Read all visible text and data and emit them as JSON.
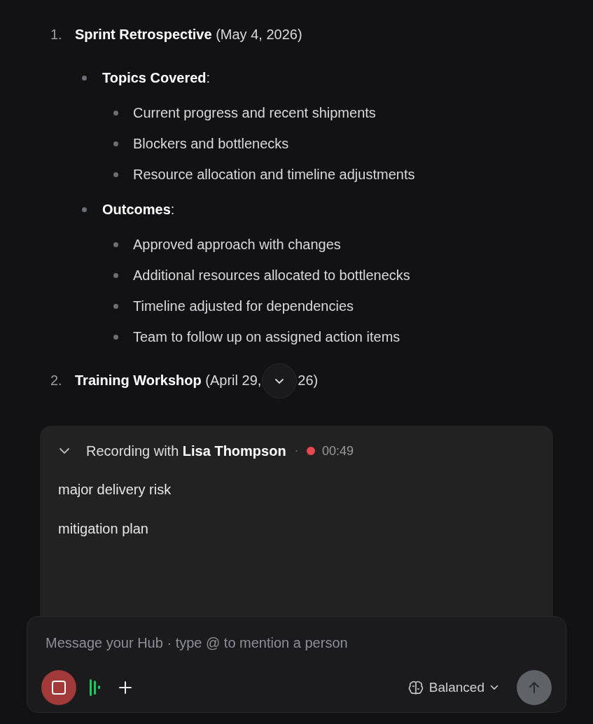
{
  "outline": [
    {
      "number": "1.",
      "text": "**Sprint Retrospective** (May 4, 2026)",
      "sections": [
        {
          "label": "**Topics Covered**:",
          "items": [
            "Current progress and recent shipments",
            "Blockers and bottlenecks",
            "Resource allocation and timeline adjustments"
          ]
        },
        {
          "label": "**Outcomes**:",
          "items": [
            "Approved approach with changes",
            "Additional resources allocated to bottlenecks",
            "Timeline adjusted for dependencies",
            "Team to follow up on assigned action items"
          ]
        }
      ]
    },
    {
      "number": "2.",
      "text": "**Training Workshop** (April 29,",
      "text_after": "26)"
    }
  ],
  "recording": {
    "expanded": true,
    "title": "Recording with **Lisa Thompson**",
    "separator": "·",
    "live": true,
    "time": "00:49",
    "lines": [
      "major delivery risk",
      "mitigation plan"
    ]
  },
  "composer": {
    "placeholder": "Message your Hub · type @ to mention a person",
    "recording": true,
    "mode": "Balanced"
  }
}
